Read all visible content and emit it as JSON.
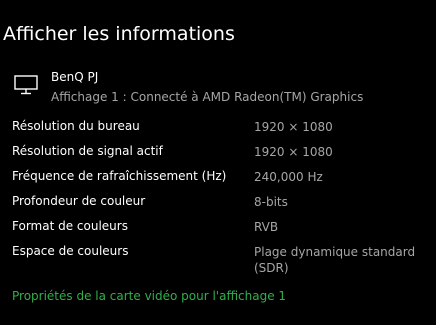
{
  "page": {
    "title": "Afficher les informations"
  },
  "display": {
    "icon": "monitor-icon",
    "name": "BenQ PJ",
    "subtitle": "Affichage 1 : Connecté à AMD Radeon(TM) Graphics"
  },
  "info_rows": [
    {
      "label": "Résolution du bureau",
      "value": "1920 × 1080"
    },
    {
      "label": "Résolution de signal actif",
      "value": "1920 × 1080"
    },
    {
      "label": "Fréquence de rafraîchissement (Hz)",
      "value": "240,000 Hz"
    },
    {
      "label": "Profondeur de couleur",
      "value": "8-bits"
    },
    {
      "label": "Format de couleurs",
      "value": "RVB"
    },
    {
      "label": "Espace de couleurs",
      "value": "Plage dynamique standard (SDR)"
    }
  ],
  "link": {
    "label": "Propriétés de la carte vidéo pour l'affichage 1"
  },
  "colors": {
    "background": "#000000",
    "text_primary": "#ffffff",
    "text_secondary": "#a6a6a6",
    "link": "#2fb04a"
  }
}
